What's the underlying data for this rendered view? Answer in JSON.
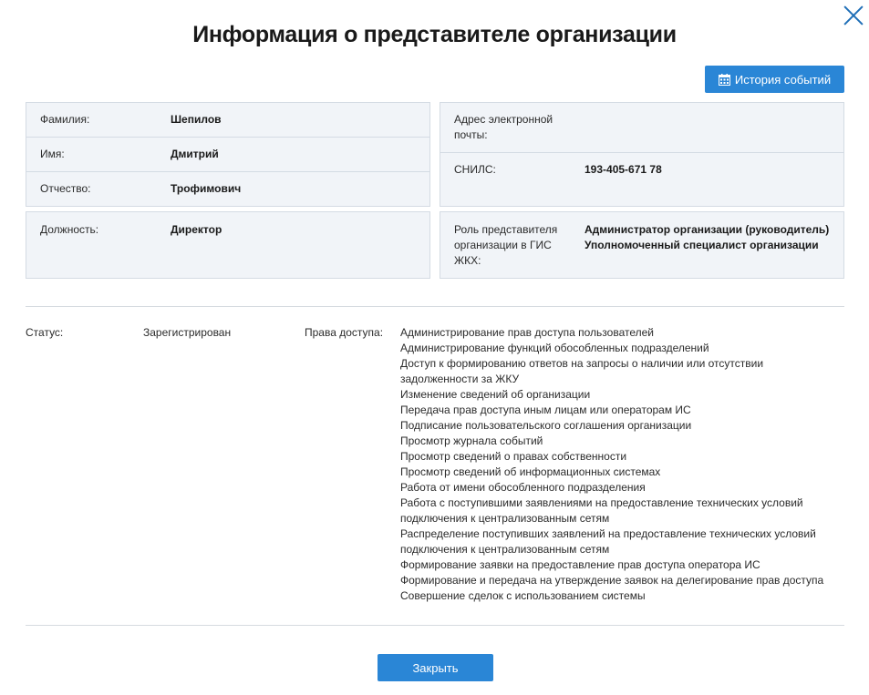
{
  "dialog": {
    "title": "Информация о представителе организации",
    "history_button": "История событий",
    "close_button": "Закрыть"
  },
  "person": {
    "surname_label": "Фамилия:",
    "surname": "Шепилов",
    "name_label": "Имя:",
    "name": "Дмитрий",
    "patronymic_label": "Отчество:",
    "patronymic": "Трофимович",
    "position_label": "Должность:",
    "position": "Директор"
  },
  "contacts": {
    "email_label": "Адрес электронной почты:",
    "email": "",
    "snils_label": "СНИЛС:",
    "snils": "193-405-671 78",
    "role_label": "Роль представителя организации в ГИС ЖКХ:",
    "roles": [
      "Администратор организации (руководитель)",
      "Уполномоченный специалист организации"
    ]
  },
  "status": {
    "label": "Статус:",
    "value": "Зарегистрирован"
  },
  "access": {
    "label": "Права доступа:",
    "items": [
      "Администрирование прав доступа пользователей",
      "Администрирование функций обособленных подразделений",
      "Доступ к формированию ответов на запросы о наличии или отсутствии задолженности за ЖКУ",
      "Изменение сведений об организации",
      "Передача прав доступа иным лицам или операторам ИС",
      "Подписание пользовательского соглашения организации",
      "Просмотр журнала событий",
      "Просмотр сведений о правах собственности",
      "Просмотр сведений об информационных системах",
      "Работа от имени обособленного подразделения",
      "Работа с поступившими заявлениями на предоставление технических условий подключения к централизованным сетям",
      "Распределение поступивших заявлений на предоставление технических условий подключения к централизованным сетям",
      "Формирование заявки на предоставление прав доступа оператора ИС",
      "Формирование и передача на утверждение заявок на делегирование прав доступа",
      "Совершение сделок с использованием системы"
    ]
  },
  "colors": {
    "accent": "#2a86d6",
    "panel_bg": "#f1f4f8",
    "panel_border": "#d4dbe3"
  },
  "icons": {
    "close": "close-icon",
    "history": "calendar-icon"
  }
}
